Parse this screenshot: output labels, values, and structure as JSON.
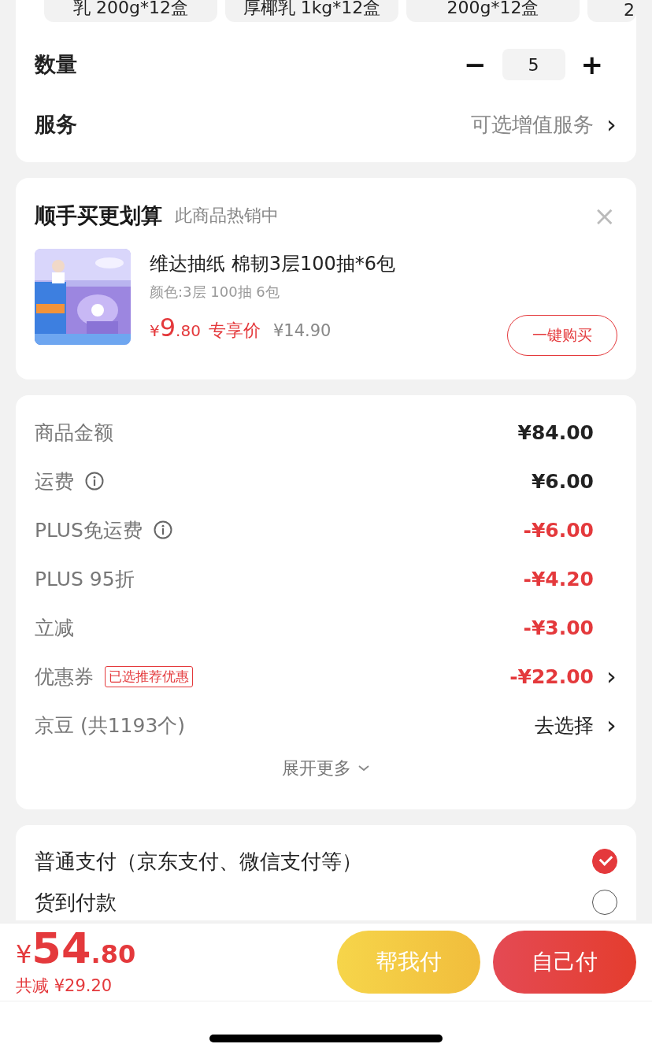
{
  "spec_chips": [
    {
      "label": "乳 200g*12盒",
      "selected": false
    },
    {
      "label": "厚椰乳 1kg*12盒",
      "selected": false
    },
    {
      "label": "200g*12盒",
      "selected": false
    },
    {
      "label": "2",
      "selected": false
    }
  ],
  "quantity": {
    "label": "数量",
    "minus": "−",
    "value": "5",
    "plus": "+"
  },
  "service": {
    "label": "服务",
    "value": "可选增值服务",
    "chevron": "›"
  },
  "addon": {
    "title": "顺手买更划算",
    "subtitle": "此商品热销中",
    "close": "×",
    "product": {
      "name": "维达抽纸 棉韧3层100抽*6包",
      "variant": "颜色:3层 100抽 6包",
      "currency": "¥",
      "price_int": "9",
      "price_dec": ".80",
      "price_label": "专享价",
      "original_price": "¥14.90",
      "button": "一键购买"
    }
  },
  "summary": {
    "rows": [
      {
        "label": "商品金额",
        "kind": "normal",
        "value": "¥84.00"
      },
      {
        "label": "运费",
        "kind": "normal",
        "info": true,
        "value": "¥6.00"
      },
      {
        "label": "PLUS免运费",
        "kind": "discount",
        "info": true,
        "value": "-¥6.00"
      },
      {
        "label": "PLUS 95折",
        "kind": "discount",
        "value": "-¥4.20"
      },
      {
        "label": "立减",
        "kind": "discount",
        "value": "-¥3.00"
      },
      {
        "label": "优惠券",
        "kind": "discount",
        "tag": "已选推荐优惠",
        "value": "-¥22.00",
        "chevron": "›"
      },
      {
        "label": "京豆 (共1193个)",
        "kind": "link",
        "value": "去选择",
        "chevron": "›"
      }
    ],
    "expand": "展开更多"
  },
  "payment": [
    {
      "label": "普通支付（京东支付、微信支付等）",
      "selected": true
    },
    {
      "label": "货到付款",
      "selected": false
    }
  ],
  "bottom_bar": {
    "currency": "¥",
    "total_int": "54",
    "total_dec": ".80",
    "saved": "共减 ¥29.20",
    "help_pay": "帮我付",
    "self_pay": "自己付"
  }
}
